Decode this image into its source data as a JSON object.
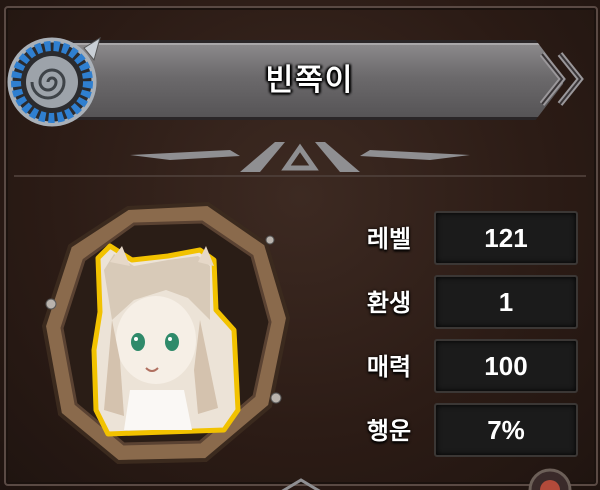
{
  "character": {
    "name": "빈쪽이"
  },
  "stats": [
    {
      "label": "레벨",
      "value": "121"
    },
    {
      "label": "환생",
      "value": "1"
    },
    {
      "label": "매력",
      "value": "100"
    },
    {
      "label": "행운",
      "value": "7%"
    }
  ],
  "icons": {
    "emblem": "spiral-shield-icon",
    "chevrons": "double-chevron-right-icon",
    "portrait": "character-portrait"
  },
  "colors": {
    "panel_bg": "#2b1b15",
    "title_bar": "#6c6a6c",
    "emblem_blue": "#2f7fd0",
    "portrait_frame": "#8a6a4c",
    "portrait_outline": "#f2c200",
    "value_box": "#1b1b1b"
  }
}
